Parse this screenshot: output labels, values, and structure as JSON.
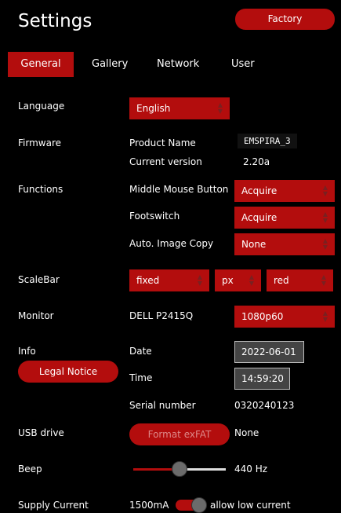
{
  "header": {
    "title": "Settings",
    "factory_label": "Factory"
  },
  "tabs": [
    {
      "label": "General",
      "active": true
    },
    {
      "label": "Gallery",
      "active": false
    },
    {
      "label": "Network",
      "active": false
    },
    {
      "label": "User",
      "active": false
    }
  ],
  "language": {
    "label": "Language",
    "value": "English"
  },
  "firmware": {
    "label": "Firmware",
    "product_name_label": "Product Name",
    "product_name": "EMSPIRA_3",
    "version_label": "Current version",
    "version": "2.20a"
  },
  "functions": {
    "label": "Functions",
    "middle_mouse_label": "Middle Mouse Button",
    "middle_mouse_value": "Acquire",
    "footswitch_label": "Footswitch",
    "footswitch_value": "Acquire",
    "auto_copy_label": "Auto. Image Copy",
    "auto_copy_value": "None"
  },
  "scalebar": {
    "label": "ScaleBar",
    "mode": "fixed",
    "unit": "px",
    "color": "red"
  },
  "monitor": {
    "label": "Monitor",
    "name": "DELL P2415Q",
    "resolution": "1080p60"
  },
  "info": {
    "label": "Info",
    "legal_notice_label": "Legal Notice",
    "date_label": "Date",
    "date": "2022-06-01",
    "time_label": "Time",
    "time": "14:59:20",
    "serial_label": "Serial number",
    "serial": "0320240123"
  },
  "usb": {
    "label": "USB drive",
    "format_label": "Format exFAT",
    "status": "None"
  },
  "beep": {
    "label": "Beep",
    "value_text": "440 Hz",
    "level": 0.5
  },
  "supply": {
    "label": "Supply Current",
    "value": "1500mA",
    "toggle_label": "allow low current",
    "toggle_on": true
  },
  "colors": {
    "accent": "#b30d0d",
    "background": "#000000",
    "field": "#444444"
  }
}
